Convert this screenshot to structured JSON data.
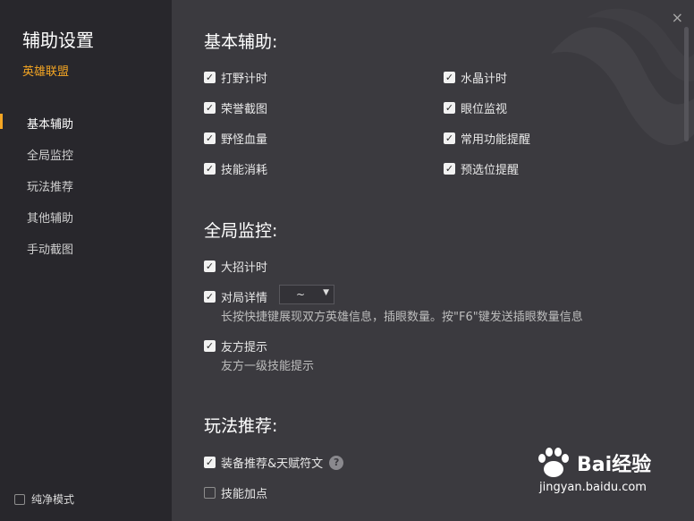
{
  "sidebar": {
    "title": "辅助设置",
    "game": "英雄联盟",
    "nav": [
      {
        "label": "基本辅助",
        "active": true
      },
      {
        "label": "全局监控",
        "active": false
      },
      {
        "label": "玩法推荐",
        "active": false
      },
      {
        "label": "其他辅助",
        "active": false
      },
      {
        "label": "手动截图",
        "active": false
      }
    ],
    "pure_mode": {
      "label": "纯净模式",
      "checked": false
    }
  },
  "window": {
    "close_icon": "×"
  },
  "sections": {
    "basic": {
      "title": "基本辅助:",
      "options": [
        {
          "label": "打野计时",
          "checked": true
        },
        {
          "label": "水晶计时",
          "checked": true
        },
        {
          "label": "荣誉截图",
          "checked": true
        },
        {
          "label": "眼位监视",
          "checked": true
        },
        {
          "label": "野怪血量",
          "checked": true
        },
        {
          "label": "常用功能提醒",
          "checked": true
        },
        {
          "label": "技能消耗",
          "checked": true
        },
        {
          "label": "预选位提醒",
          "checked": true
        }
      ]
    },
    "global": {
      "title": "全局监控:",
      "ult_timer": {
        "label": "大招计时",
        "checked": true
      },
      "match_detail": {
        "label": "对局详情",
        "checked": true,
        "dropdown_value": "~",
        "desc": "长按快捷键展现双方英雄信息，插眼数量。按\"F6\"键发送插眼数量信息"
      },
      "ally_tip": {
        "label": "友方提示",
        "checked": true,
        "desc": "友方一级技能提示"
      }
    },
    "play": {
      "title": "玩法推荐:",
      "equip": {
        "label": "装备推荐&天赋符文",
        "checked": true,
        "help": "?"
      },
      "skill": {
        "label": "技能加点",
        "checked": false
      }
    }
  },
  "watermark": {
    "text": "Bai经验",
    "url": "jingyan.baidu.com"
  },
  "colors": {
    "accent": "#f5a623",
    "sidebar_bg": "#28272c",
    "main_bg": "#3b3a3f"
  }
}
